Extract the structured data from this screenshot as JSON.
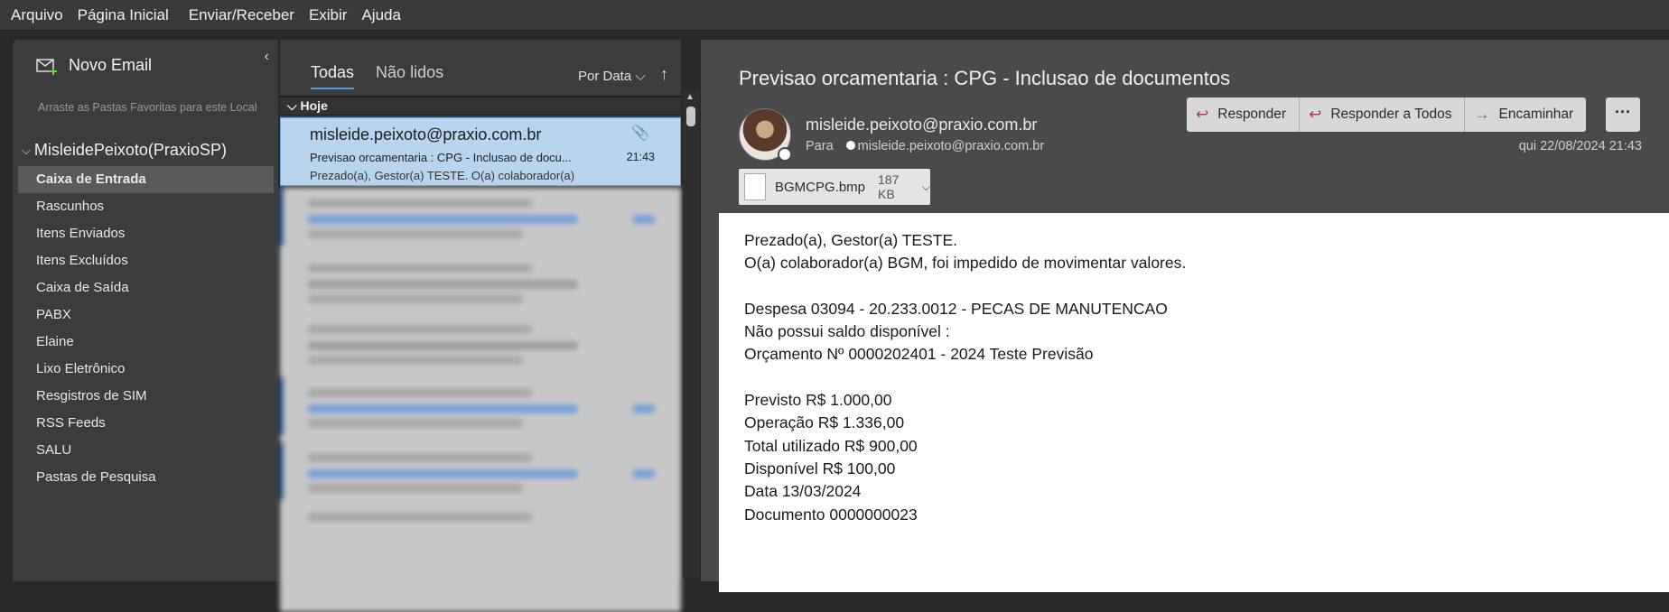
{
  "menu": [
    "Arquivo",
    "Página Inicial",
    "Enviar/Receber",
    "Exibir",
    "Ajuda"
  ],
  "sidebar": {
    "new_mail": "Novo Email",
    "fav_hint": "Arraste as Pastas Favoritas para este Local",
    "account": "MisleideP​eixoto(PraxioSP)",
    "folders": [
      "Caixa de Entrada",
      "Rascunhos",
      "Itens Enviados",
      "Itens Excluídos",
      "Caixa de Saída",
      "PABX",
      "Elaine",
      "Lixo Eletrônico",
      "Resgistros de SIM",
      "RSS Feeds",
      "SALU",
      "Pastas de Pesquisa"
    ]
  },
  "list": {
    "tab_all": "Todas",
    "tab_unread": "Não lidos",
    "sort_label": "Por Data",
    "group": "Hoje",
    "selected": {
      "from": "misleide.peixoto@praxio.com.br",
      "subject": "Previsao orcamentaria : CPG - Inclusao de docu...",
      "preview": "Prezado(a), Gestor(a) TESTE. O(a) colaborador(a)",
      "time": "21:43"
    }
  },
  "reader": {
    "title": "Previsao orcamentaria : CPG - Inclusao de documentos",
    "sender": "misleide.peixoto@praxio.com.br",
    "to_label": "Para",
    "to_address": "misleide.peixoto@praxio.com.br",
    "date": "qui 22/08/2024 21:43",
    "actions": {
      "reply": "Responder",
      "reply_all": "Responder a Todos",
      "forward": "Encaminhar",
      "more": "···"
    },
    "attachment": {
      "name": "BGMCPG.bmp",
      "size": "187 KB"
    },
    "body": [
      "Prezado(a), Gestor(a) TESTE.",
      "O(a) colaborador(a) BGM, foi impedido de movimentar valores.",
      "",
      "Despesa 03094 - 20.233.0012 - PECAS DE MANUTENCAO",
      "Não possui saldo disponível :",
      "Orçamento Nº 0000202401 - 2024 Teste Previsão",
      "",
      "Previsto R$ 1.000,00",
      "Operação R$ 1.336,00",
      "Total utilizado R$ 900,00",
      "Disponível R$ 100,00",
      "Data 13/03/2024",
      "Documento 0000000023"
    ]
  }
}
